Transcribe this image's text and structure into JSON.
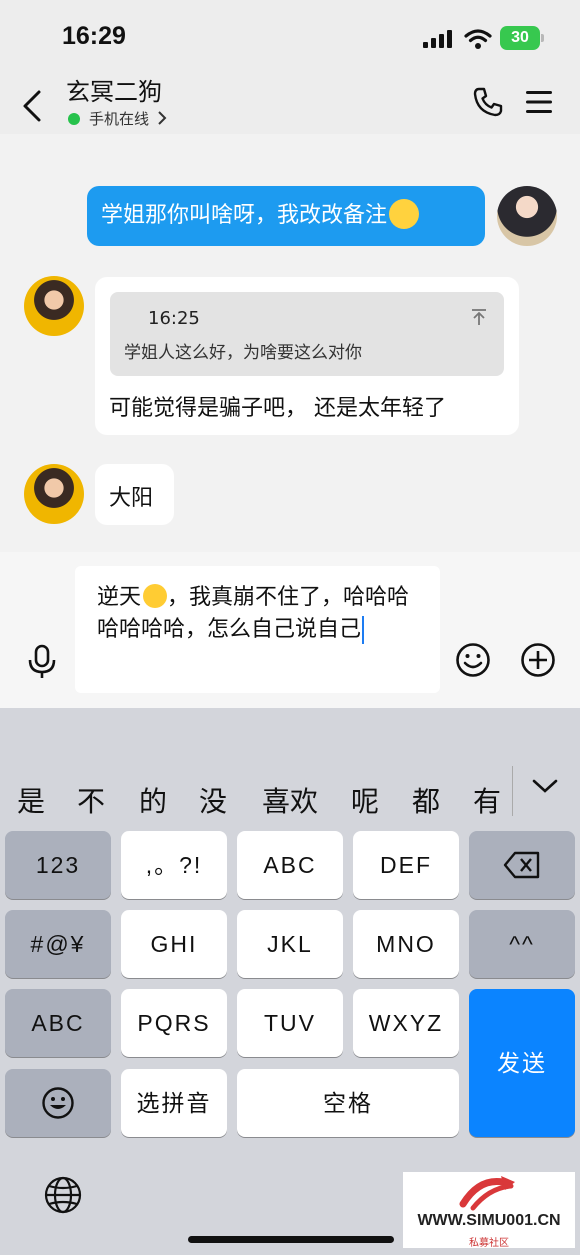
{
  "status_bar": {
    "time": "16:29",
    "battery": "30"
  },
  "header": {
    "contact_name": "玄冥二狗",
    "online_status": "手机在线"
  },
  "messages": [
    {
      "side": "out",
      "text": "学姐那你叫啥呀，我改改备注"
    },
    {
      "side": "in",
      "quote_time": "16:25",
      "quote_text": "学姐人这么好，为啥要这么对你",
      "text": "可能觉得是骗子吧， 还是太年轻了"
    },
    {
      "side": "in",
      "text": "大阳"
    }
  ],
  "input": {
    "text_before_emoji": "逆天",
    "text_after_emoji": "，我真崩不住了，哈哈哈哈哈哈哈，怎么自己说自己"
  },
  "candidates": [
    "是",
    "不",
    "的",
    "没",
    "喜欢",
    "呢",
    "都",
    "有"
  ],
  "keys": {
    "num": "123",
    "punct": ",。?!",
    "abc": "ABC",
    "def": "DEF",
    "sym": "#@¥",
    "ghi": "GHI",
    "jkl": "JKL",
    "mno": "MNO",
    "face": "^^",
    "abc_mode": "ABC",
    "pqrs": "PQRS",
    "tuv": "TUV",
    "wxyz": "WXYZ",
    "send": "发送",
    "pinyin": "选拼音",
    "space": "空格"
  },
  "watermark": {
    "text": "WWW.SIMU001.CN",
    "sub": "私募社区"
  },
  "colors": {
    "accent_blue": "#1d9bf0",
    "send_key": "#0b84ff",
    "online": "#27c24c"
  }
}
